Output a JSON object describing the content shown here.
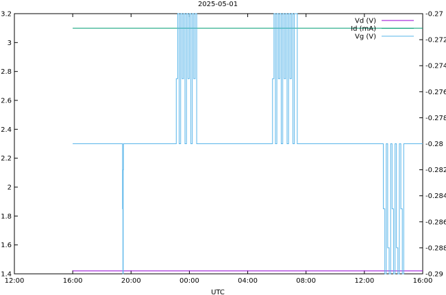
{
  "chart_data": {
    "type": "line",
    "title": "2025-05-01",
    "xlabel": "UTC",
    "ylabel_left": "",
    "ylabel_right": "",
    "x_unit": "hours since 12:00 (2025-04-30)",
    "xlim": [
      0,
      28
    ],
    "ylim_left": [
      1.4,
      3.2
    ],
    "ylim_right": [
      -0.29,
      -0.27
    ],
    "x_ticks": [
      "12:00",
      "16:00",
      "20:00",
      "00:00",
      "04:00",
      "08:00",
      "12:00",
      "16:00"
    ],
    "y_ticks_left": [
      "1.4",
      "1.6",
      "1.8",
      "2",
      "2.2",
      "2.4",
      "2.6",
      "2.8",
      "3",
      "3.2"
    ],
    "y_ticks_right": [
      "-0.29",
      "-0.288",
      "-0.286",
      "-0.284",
      "-0.282",
      "-0.28",
      "-0.278",
      "-0.276",
      "-0.274",
      "-0.272",
      "-0.27"
    ],
    "legend": {
      "placement": "top-right"
    },
    "series": [
      {
        "name": "Vd (V)",
        "axis": "left",
        "color": "#9400d3",
        "x": [
          4,
          28
        ],
        "y": [
          1.42,
          1.42
        ]
      },
      {
        "name": "Id (mA)",
        "axis": "left",
        "color": "#009e73",
        "x": [
          4,
          28
        ],
        "y": [
          3.1,
          3.1
        ]
      },
      {
        "name": "Vg (V)",
        "axis": "right",
        "color": "#56b4e9",
        "x": [
          4,
          7.4,
          7.42,
          7.44,
          7.46,
          7.48,
          7.5,
          11,
          11.1,
          11.2,
          11.3,
          11.4,
          11.5,
          11.6,
          11.7,
          11.8,
          11.9,
          12.0,
          12.1,
          12.2,
          12.3,
          12.4,
          12.5,
          17.6,
          17.7,
          17.8,
          17.9,
          18.0,
          18.1,
          18.2,
          18.3,
          18.4,
          18.5,
          18.6,
          18.7,
          18.8,
          18.9,
          19.0,
          19.1,
          19.2,
          19.4,
          25.2,
          25.3,
          25.4,
          25.5,
          25.6,
          25.7,
          25.8,
          25.9,
          26.0,
          26.1,
          26.2,
          26.3,
          26.4,
          26.5,
          26.6,
          26.7,
          26.8,
          28
        ],
        "y": [
          -0.28,
          -0.28,
          -0.285,
          -0.29,
          -0.282,
          -0.28,
          -0.28,
          -0.28,
          -0.275,
          -0.27,
          -0.28,
          -0.27,
          -0.275,
          -0.27,
          -0.28,
          -0.27,
          -0.275,
          -0.27,
          -0.28,
          -0.27,
          -0.275,
          -0.27,
          -0.28,
          -0.28,
          -0.275,
          -0.27,
          -0.28,
          -0.27,
          -0.275,
          -0.27,
          -0.28,
          -0.27,
          -0.275,
          -0.27,
          -0.28,
          -0.27,
          -0.275,
          -0.27,
          -0.28,
          -0.27,
          -0.28,
          -0.28,
          -0.285,
          -0.29,
          -0.28,
          -0.288,
          -0.29,
          -0.28,
          -0.285,
          -0.29,
          -0.28,
          -0.288,
          -0.29,
          -0.28,
          -0.285,
          -0.29,
          -0.28,
          -0.28,
          -0.28
        ]
      }
    ]
  }
}
